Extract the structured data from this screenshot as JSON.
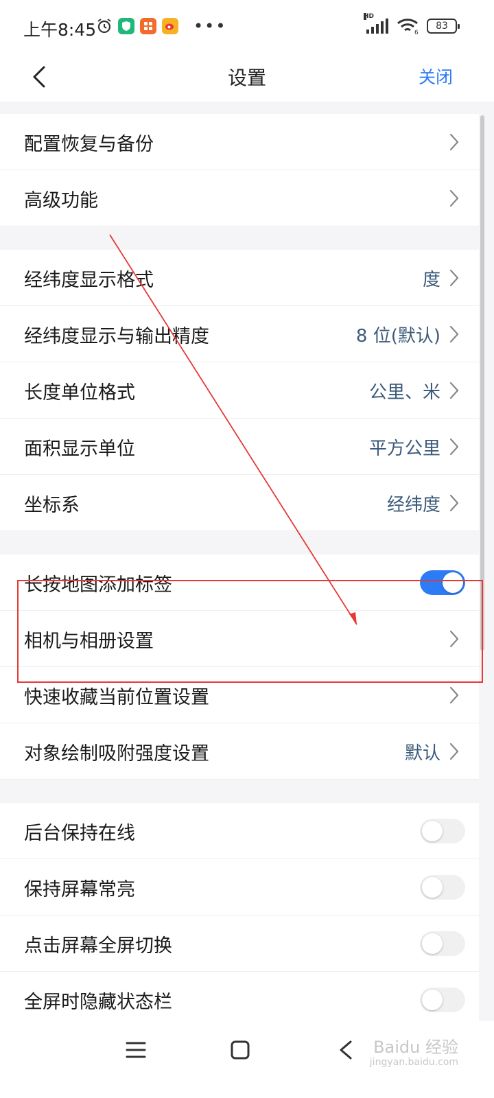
{
  "status_bar": {
    "time": "上午8:45",
    "network_badge": "HD",
    "wifi_badge": "6",
    "battery": "83"
  },
  "header": {
    "title": "设置",
    "close_label": "关闭"
  },
  "groups": [
    {
      "rows": [
        {
          "label": "配置恢复与备份",
          "value": "",
          "control": "chevron"
        },
        {
          "label": "高级功能",
          "value": "",
          "control": "chevron"
        }
      ]
    },
    {
      "rows": [
        {
          "label": "经纬度显示格式",
          "value": "度",
          "control": "chevron"
        },
        {
          "label": "经纬度显示与输出精度",
          "value": "8 位(默认)",
          "control": "chevron"
        },
        {
          "label": "长度单位格式",
          "value": "公里、米",
          "control": "chevron"
        },
        {
          "label": "面积显示单位",
          "value": "平方公里",
          "control": "chevron"
        },
        {
          "label": "坐标系",
          "value": "经纬度",
          "control": "chevron"
        }
      ]
    },
    {
      "rows": [
        {
          "label": "长按地图添加标签",
          "value": "",
          "control": "toggle",
          "on": true
        },
        {
          "label": "相机与相册设置",
          "value": "",
          "control": "chevron"
        },
        {
          "label": "快速收藏当前位置设置",
          "value": "",
          "control": "chevron"
        },
        {
          "label": "对象绘制吸附强度设置",
          "value": "默认",
          "control": "chevron"
        }
      ]
    },
    {
      "rows": [
        {
          "label": "后台保持在线",
          "value": "",
          "control": "toggle",
          "on": false
        },
        {
          "label": "保持屏幕常亮",
          "value": "",
          "control": "toggle",
          "on": false
        },
        {
          "label": "点击屏幕全屏切换",
          "value": "",
          "control": "toggle",
          "on": false
        },
        {
          "label": "全屏时隐藏状态栏",
          "value": "",
          "control": "toggle",
          "on": false
        }
      ]
    }
  ],
  "watermark": {
    "text": "Baidu 经验",
    "sub": "jingyan.baidu.com"
  },
  "colors": {
    "accent": "#2d7cf6",
    "value_text": "#3c5a7a",
    "annotation": "#e53935"
  }
}
